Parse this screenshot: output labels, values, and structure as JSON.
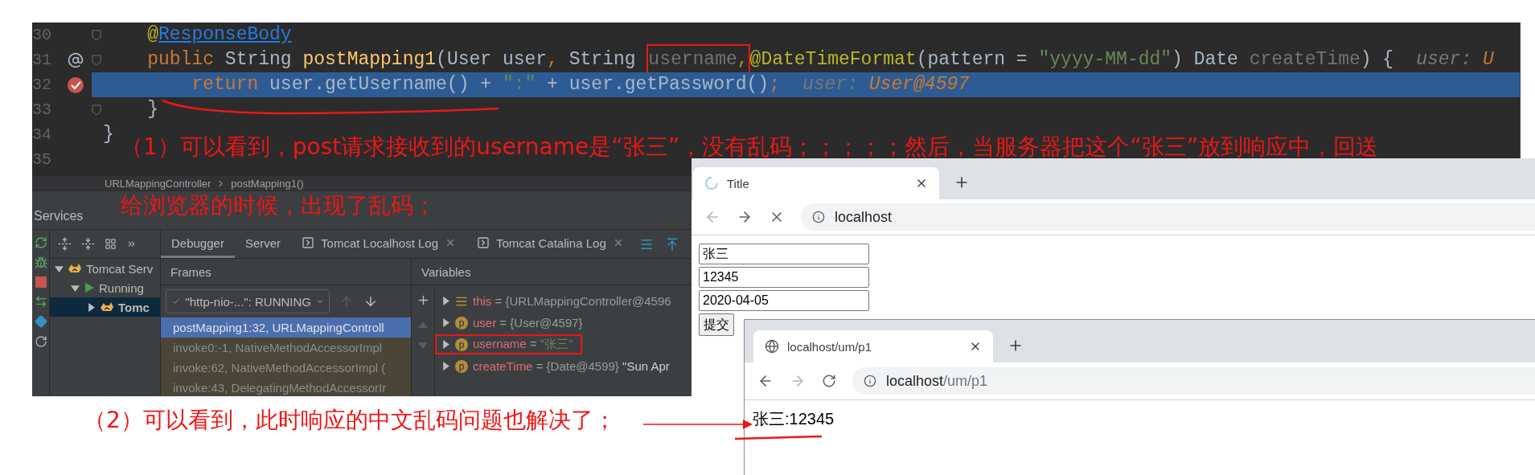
{
  "editor": {
    "lines": [
      {
        "number": "30",
        "fold": true,
        "highlighted": false,
        "tokens": [
          {
            "kind": "annotation",
            "text": "    @"
          },
          {
            "kind": "link",
            "text": "ResponseBody"
          }
        ]
      },
      {
        "number": "31",
        "marker": {
          "kind": "at"
        },
        "fold": true,
        "highlighted": false,
        "tokens": [
          {
            "kind": "keyword",
            "text": "    public"
          },
          {
            "kind": "plain",
            "text": " String "
          },
          {
            "kind": "method",
            "text": "postMapping1"
          },
          {
            "kind": "plain",
            "text": "(User user"
          },
          {
            "kind": "keyword",
            "text": ","
          },
          {
            "kind": "plain",
            "text": " String "
          },
          {
            "kind": "unused",
            "text": "username",
            "boxed": true
          },
          {
            "kind": "keyword",
            "text": ",",
            "boxed": true
          },
          {
            "kind": "annotation",
            "text": "@DateTimeFormat"
          },
          {
            "kind": "plain",
            "text": "(pattern = "
          },
          {
            "kind": "string",
            "text": "\"yyyy-MM-dd\""
          },
          {
            "kind": "plain",
            "text": ") Date "
          },
          {
            "kind": "unused",
            "text": "createTime"
          },
          {
            "kind": "plain",
            "text": ") {"
          }
        ],
        "hint": {
          "label": "user:",
          "value": "U"
        }
      },
      {
        "number": "32",
        "marker": {
          "kind": "breakpoint"
        },
        "fold": false,
        "highlighted": true,
        "tokens": [
          {
            "kind": "keyword",
            "text": "        return"
          },
          {
            "kind": "plain",
            "text": " user.getUsername() + "
          },
          {
            "kind": "string",
            "text": "\":\""
          },
          {
            "kind": "plain",
            "text": " + user.getPassword()"
          },
          {
            "kind": "keyword",
            "text": ";"
          }
        ],
        "hint": {
          "label": "user:",
          "value": "User@4597"
        }
      },
      {
        "number": "33",
        "fold": true,
        "highlighted": false,
        "tokens": [
          {
            "kind": "plain",
            "text": "    }"
          }
        ]
      },
      {
        "number": "34",
        "fold": false,
        "highlighted": false,
        "tokens": [
          {
            "kind": "plain",
            "text": "}"
          }
        ]
      },
      {
        "number": "35",
        "fold": false,
        "highlighted": false
      }
    ]
  },
  "breadcrumbs": [
    "URLMappingController",
    "postMapping1()"
  ],
  "services": {
    "title": "Services",
    "tree": [
      {
        "label": "Tomcat Serv",
        "kind": "server",
        "expanded": true,
        "selected": false,
        "children": [
          {
            "label": "Running",
            "kind": "status",
            "expanded": true,
            "selected": false,
            "children": [
              {
                "label": "Tomc",
                "kind": "instance",
                "expanded": false,
                "selected": true
              }
            ]
          }
        ]
      }
    ],
    "tabs": [
      {
        "label": "Debugger",
        "selected": true,
        "closable": false
      },
      {
        "label": "Server",
        "selected": false,
        "closable": false
      },
      {
        "label": "Tomcat Localhost Log",
        "selected": false,
        "closable": true
      },
      {
        "label": "Tomcat Catalina Log",
        "selected": false,
        "closable": true
      }
    ],
    "frames": {
      "title": "Frames",
      "thread": "\"http-nio-...\": RUNNING",
      "thread_nav": [
        {
          "kind": "up",
          "disabled": true
        },
        {
          "kind": "down",
          "disabled": false
        }
      ],
      "items": [
        {
          "label": "postMapping1:32, URLMappingControll",
          "selected": true,
          "library": false
        },
        {
          "label": "invoke0:-1, NativeMethodAccessorImpl",
          "selected": false,
          "library": true
        },
        {
          "label": "invoke:62, NativeMethodAccessorImpl (",
          "selected": false,
          "library": true
        },
        {
          "label": "invoke:43, DelegatingMethodAccessorIr",
          "selected": false,
          "library": true
        }
      ]
    },
    "variables": {
      "title": "Variables",
      "items": [
        {
          "kind": "self",
          "name": "this",
          "operator": "=",
          "value": "{URLMappingController@4596",
          "string": false,
          "boxed": false
        },
        {
          "kind": "field",
          "badge": "p",
          "name": "user",
          "operator": "=",
          "value": "{User@4597}",
          "string": false,
          "boxed": false
        },
        {
          "kind": "field",
          "badge": "p",
          "name": "username",
          "operator": "=",
          "value": "\"张三\"",
          "string": true,
          "boxed": true
        },
        {
          "kind": "field",
          "badge": "p",
          "name": "createTime",
          "operator": "=",
          "value": "{Date@4599}",
          "preview": "\"Sun Apr",
          "string": false,
          "boxed": false
        }
      ]
    }
  },
  "browser_1": {
    "tab": {
      "title": "Title",
      "loading": true,
      "selected": true
    },
    "nav": [
      {
        "kind": "back",
        "disabled": true
      },
      {
        "kind": "forward",
        "disabled": false
      },
      {
        "kind": "stop",
        "disabled": false
      }
    ],
    "url": {
      "host": "localhost"
    },
    "form": {
      "fields": [
        {
          "value": "张三"
        },
        {
          "value": "12345"
        },
        {
          "value": "2020-04-05"
        }
      ],
      "submit": "提交"
    }
  },
  "browser_2": {
    "tab": {
      "title": "localhost/um/p1",
      "loading": false,
      "selected": true
    },
    "nav": [
      {
        "kind": "back",
        "disabled": false
      },
      {
        "kind": "forward",
        "disabled": true
      },
      {
        "kind": "reload",
        "disabled": false
      }
    ],
    "url": {
      "host": "localhost",
      "path": "/um/p1"
    },
    "body": "张三:12345"
  },
  "annotations": [
    {
      "lines": [
        "（1）可以看到，post请求接收到的username是“张三”，没有乱码；；；；；然后，当服务器把这个“张三”放到响应中，回送",
        "给浏览器的时候，出现了乱码；"
      ]
    },
    {
      "lines": [
        "（2）可以看到，此时响应的中文乱码问题也解决了；"
      ]
    }
  ]
}
